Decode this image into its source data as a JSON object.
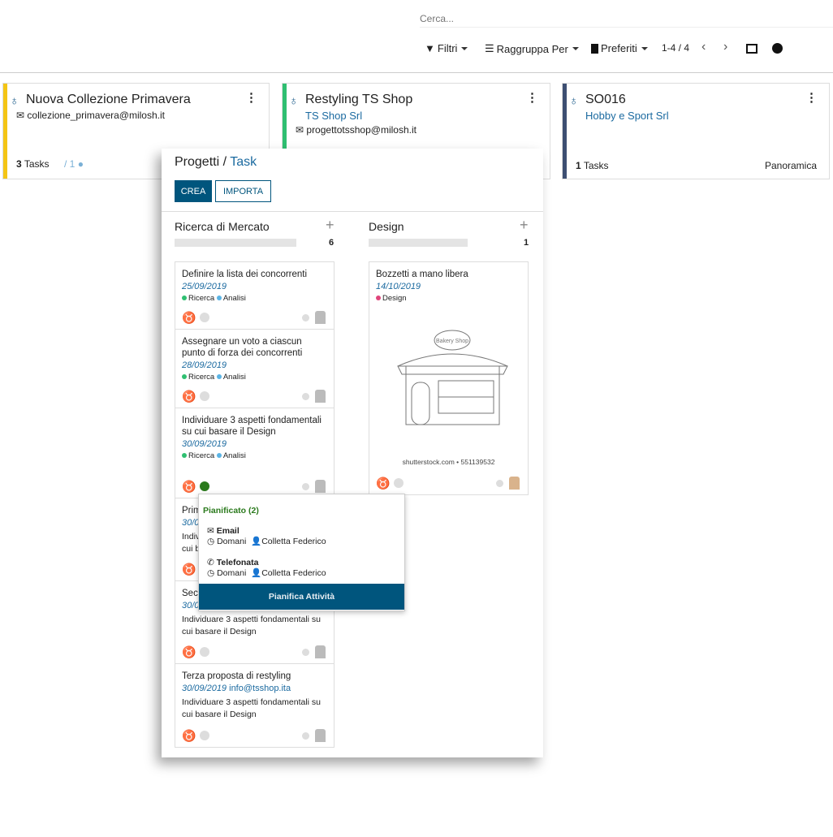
{
  "search": {
    "placeholder": "Cerca..."
  },
  "toolbar": {
    "filters": "Filtri",
    "group_by": "Raggruppa Per",
    "favorites": "Preferiti",
    "pager": "1-4 / 4"
  },
  "projects": [
    {
      "title": "Nuova Collezione Primavera",
      "email": "collezione_primavera@milosh.it",
      "tasks_count": "3",
      "tasks_label": "Tasks",
      "messages": "/ 1",
      "color": "#f4c514"
    },
    {
      "title": "Restyling TS Shop",
      "partner": "TS Shop Srl",
      "email": "progettotsshop@milosh.it",
      "color": "#2fbf71"
    },
    {
      "title": "SO016",
      "partner": "Hobby e Sport Srl",
      "tasks_count": "1",
      "tasks_label": "Tasks",
      "overview": "Panoramica",
      "color": "#3d4f72"
    }
  ],
  "panel": {
    "breadcrumb_root": "Progetti /",
    "breadcrumb_current": "Task",
    "create": "CREA",
    "import": "IMPORTA",
    "columns": [
      {
        "name": "Ricerca di Mercato",
        "count": "6"
      },
      {
        "name": "Design",
        "count": "1"
      }
    ],
    "tasks_col1": [
      {
        "name": "Definire la lista dei concorrenti",
        "date": "25/09/2019",
        "tags": [
          "Ricerca",
          "Analisi"
        ]
      },
      {
        "name": "Assegnare un voto a ciascun punto di forza dei concorrenti",
        "date": "28/09/2019",
        "tags": [
          "Ricerca",
          "Analisi"
        ]
      },
      {
        "name": "Individuare 3 aspetti fondamentali su cui basare il Design",
        "date": "30/09/2019",
        "tags": [
          "Ricerca",
          "Analisi"
        ]
      },
      {
        "name": "Prim",
        "date": "30/0",
        "desc": "Indiv",
        "desc2": "cui b"
      },
      {
        "name": "Seco",
        "date": "30/0",
        "desc": "Individuare 3 aspetti fondamentali su cui basare il Design"
      },
      {
        "name": "Terza proposta di restyling",
        "date": "30/09/2019",
        "email": "info@tsshop.ita",
        "desc": "Individuare 3 aspetti fondamentali su cui basare il Design"
      }
    ],
    "task_col2": {
      "name": "Bozzetti a mano libera",
      "date": "14/10/2019",
      "tag": "Design",
      "image_caption": "shutterstock.com • 551139532",
      "sign_text": "Bakery Shop"
    },
    "tag_colors": {
      "Ricerca": "#2fbf71",
      "Analisi": "#5bb4e5",
      "Design": "#e0457b"
    }
  },
  "popup": {
    "title": "Pianificato (2)",
    "activities": [
      {
        "type": "Email",
        "when": "Domani",
        "user": "Colletta Federico"
      },
      {
        "type": "Telefonata",
        "when": "Domani",
        "user": "Colletta Federico"
      }
    ],
    "action": "Pianifica Attività"
  },
  "colors": {
    "primary": "#00557d",
    "link": "#1b6aa0",
    "planned": "#2b7a1d"
  }
}
